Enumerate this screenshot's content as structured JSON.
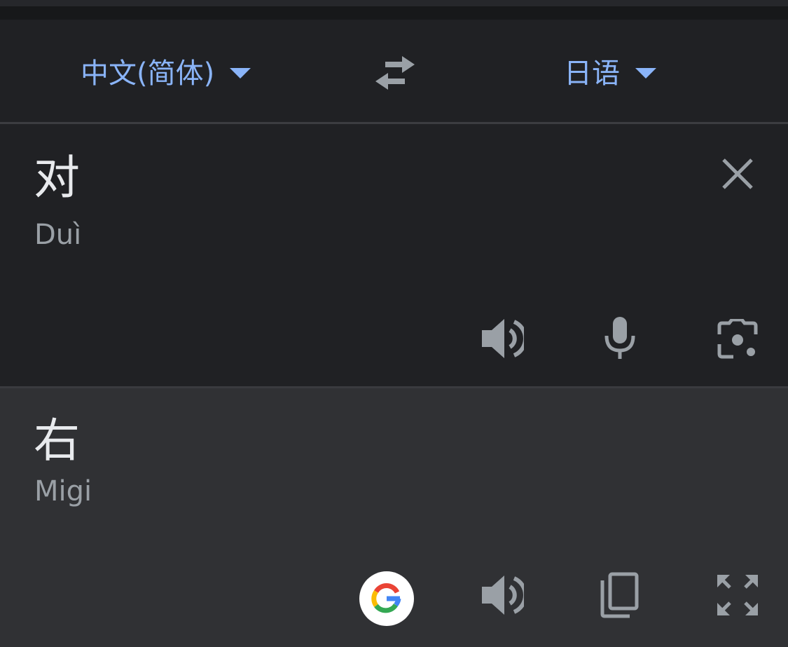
{
  "language_bar": {
    "source_language": "中文(简体)",
    "target_language": "日语",
    "swap_icon": "swap-arrows-icon"
  },
  "source": {
    "text": "对",
    "romanization": "Duì",
    "icons": [
      "close-icon",
      "speaker-icon",
      "microphone-icon",
      "camera-lens-icon"
    ]
  },
  "target": {
    "text": "右",
    "romanization": "Migi",
    "icons": [
      "google-logo-icon",
      "speaker-icon",
      "copy-icon",
      "fullscreen-icon"
    ]
  },
  "colors": {
    "accent": "#8ab4f8",
    "background": "#202124",
    "target_background": "#303134",
    "icon": "#9aa0a6",
    "text": "#e8eaed"
  }
}
